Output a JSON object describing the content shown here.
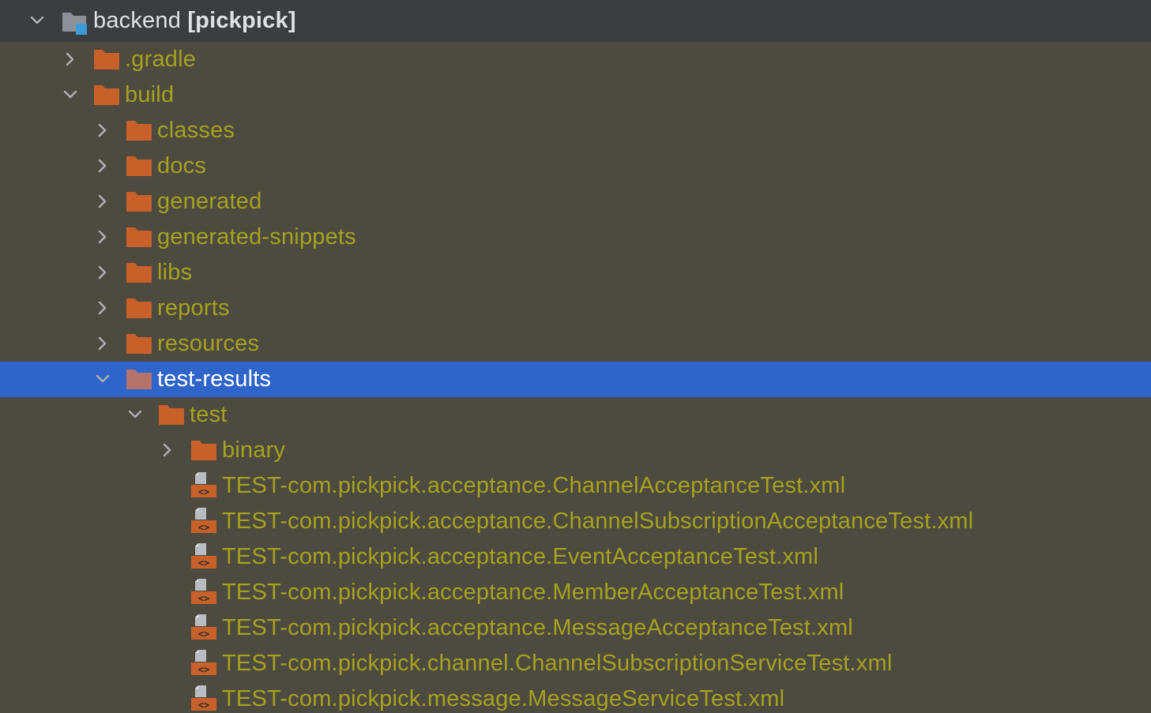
{
  "colors": {
    "background": "#4d4a40",
    "root_background": "#3b3e41",
    "selection": "#2f65ca",
    "folder_orange": "#c8602a",
    "folder_selected": "#b5746b",
    "label_olive": "#a6a21d",
    "root_text": "#dfe1e5",
    "chevron": "#aeb0b3"
  },
  "root": {
    "icon": "module-folder-icon",
    "name": "backend",
    "project": "[pickpick]",
    "expanded": true
  },
  "tree": [
    {
      "label": ".gradle",
      "icon": "folder-icon",
      "chevron": "right",
      "depth": 1
    },
    {
      "label": "build",
      "icon": "folder-icon",
      "chevron": "down",
      "depth": 1
    },
    {
      "label": "classes",
      "icon": "folder-icon",
      "chevron": "right",
      "depth": 2
    },
    {
      "label": "docs",
      "icon": "folder-icon",
      "chevron": "right",
      "depth": 2
    },
    {
      "label": "generated",
      "icon": "folder-icon",
      "chevron": "right",
      "depth": 2
    },
    {
      "label": "generated-snippets",
      "icon": "folder-icon",
      "chevron": "right",
      "depth": 2
    },
    {
      "label": "libs",
      "icon": "folder-icon",
      "chevron": "right",
      "depth": 2
    },
    {
      "label": "reports",
      "icon": "folder-icon",
      "chevron": "right",
      "depth": 2
    },
    {
      "label": "resources",
      "icon": "folder-icon",
      "chevron": "right",
      "depth": 2
    },
    {
      "label": "test-results",
      "icon": "folder-icon",
      "chevron": "down",
      "depth": 2,
      "selected": true
    },
    {
      "label": "test",
      "icon": "folder-icon",
      "chevron": "down",
      "depth": 3
    },
    {
      "label": "binary",
      "icon": "folder-icon",
      "chevron": "right",
      "depth": 4
    },
    {
      "label": "TEST-com.pickpick.acceptance.ChannelAcceptanceTest.xml",
      "icon": "xml-file-icon",
      "chevron": "none",
      "depth": 4
    },
    {
      "label": "TEST-com.pickpick.acceptance.ChannelSubscriptionAcceptanceTest.xml",
      "icon": "xml-file-icon",
      "chevron": "none",
      "depth": 4
    },
    {
      "label": "TEST-com.pickpick.acceptance.EventAcceptanceTest.xml",
      "icon": "xml-file-icon",
      "chevron": "none",
      "depth": 4
    },
    {
      "label": "TEST-com.pickpick.acceptance.MemberAcceptanceTest.xml",
      "icon": "xml-file-icon",
      "chevron": "none",
      "depth": 4
    },
    {
      "label": "TEST-com.pickpick.acceptance.MessageAcceptanceTest.xml",
      "icon": "xml-file-icon",
      "chevron": "none",
      "depth": 4
    },
    {
      "label": "TEST-com.pickpick.channel.ChannelSubscriptionServiceTest.xml",
      "icon": "xml-file-icon",
      "chevron": "none",
      "depth": 4
    },
    {
      "label": "TEST-com.pickpick.message.MessageServiceTest.xml",
      "icon": "xml-file-icon",
      "chevron": "none",
      "depth": 4
    }
  ]
}
